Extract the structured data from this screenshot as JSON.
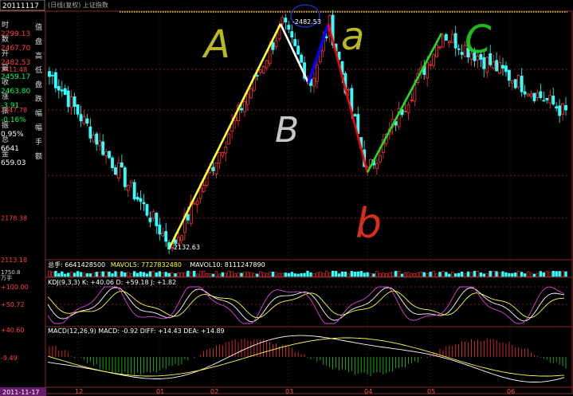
{
  "window": {
    "date_box": "20111117",
    "header": "(日线(复权) 上证指数",
    "high_label": "-2482.53",
    "low_label": "-2132.63",
    "bottom_date": "2011-11-17"
  },
  "info_panel": {
    "items": [
      {
        "key": "时",
        "value": "2299.13",
        "color": "#ff4040"
      },
      {
        "key": "数",
        "value": "2467.70",
        "color": "#ff4040"
      },
      {
        "key": "开",
        "value": "2482.53",
        "color": "#ff4040"
      },
      {
        "key": "最",
        "value": "2459.17",
        "color": "#00ff66"
      },
      {
        "key": "收",
        "value": "2463.80",
        "color": "#00ff66"
      },
      {
        "key": "涨",
        "value": "-3.91",
        "color": "#00ff66"
      },
      {
        "key": "张",
        "value": "-0.16%",
        "color": "#00ff66"
      },
      {
        "key": "振",
        "value": "0.95%",
        "color": "#ffffff"
      },
      {
        "key": "总",
        "value": "6641",
        "color": "#ffffff"
      },
      {
        "key": "金",
        "value": "659.03",
        "color": "#ffffff"
      }
    ],
    "side_chars": [
      "值",
      "盘",
      "高",
      "低",
      "盘",
      "跌",
      "幅",
      "幅",
      "手",
      "额"
    ]
  },
  "price_axis": {
    "ticks": [
      "2411.48",
      "2347.78",
      "2178.38",
      "2113.18"
    ]
  },
  "volume_panel": {
    "legend": [
      {
        "text": "总手: 6641428500",
        "color": "#ffffff"
      },
      {
        "text": "MAVOL5: 7727832480",
        "color": "#ffff00"
      },
      {
        "text": "MAVOL10: 8111247890",
        "color": "#ffffff"
      }
    ],
    "axis_top": "1750.8",
    "axis_unit": "万手"
  },
  "kdj_panel": {
    "legend": "KDJ(9,3,3) K: +40.06 D: +59.18 J: +1.82",
    "ticks": [
      "+100.00",
      "+50.72"
    ]
  },
  "macd_panel": {
    "legend": "MACD(12,26,9) MACD: -0.92 DIFF: +14.43 DEA: +14.89",
    "ticks": [
      "+40.60",
      "-9.49"
    ]
  },
  "x_axis": {
    "labels": [
      "12",
      "01",
      "02",
      "03",
      "04",
      "05",
      "06"
    ]
  },
  "annotations": {
    "labels": [
      "A",
      "B",
      "a",
      "b",
      "C"
    ]
  },
  "colors": {
    "up": "#ff3333",
    "down": "#33ffff",
    "line_A": "#ffff33",
    "line_B": "#ffffff",
    "line_a": "#0000ff",
    "line_b": "#ff0000",
    "line_C": "#22dd22"
  },
  "chart_data": {
    "type": "candlestick",
    "title": "上证指数 日线(复权)",
    "ylim": [
      2113.18,
      2500
    ],
    "points": [
      {
        "t": "2010-11",
        "close": 2400
      },
      {
        "t": "2011-01-25",
        "close": 2132.63
      },
      {
        "t": "2011-03-04",
        "close": 2482.53
      },
      {
        "t": "2011-03-16",
        "close": 2390
      },
      {
        "t": "2011-04-18",
        "close": 2482.53
      },
      {
        "t": "2011-04-28",
        "close": 2250
      },
      {
        "t": "2011-06-20",
        "close": 2467.7
      },
      {
        "t": "2011-07-20",
        "close": 2340
      }
    ]
  }
}
